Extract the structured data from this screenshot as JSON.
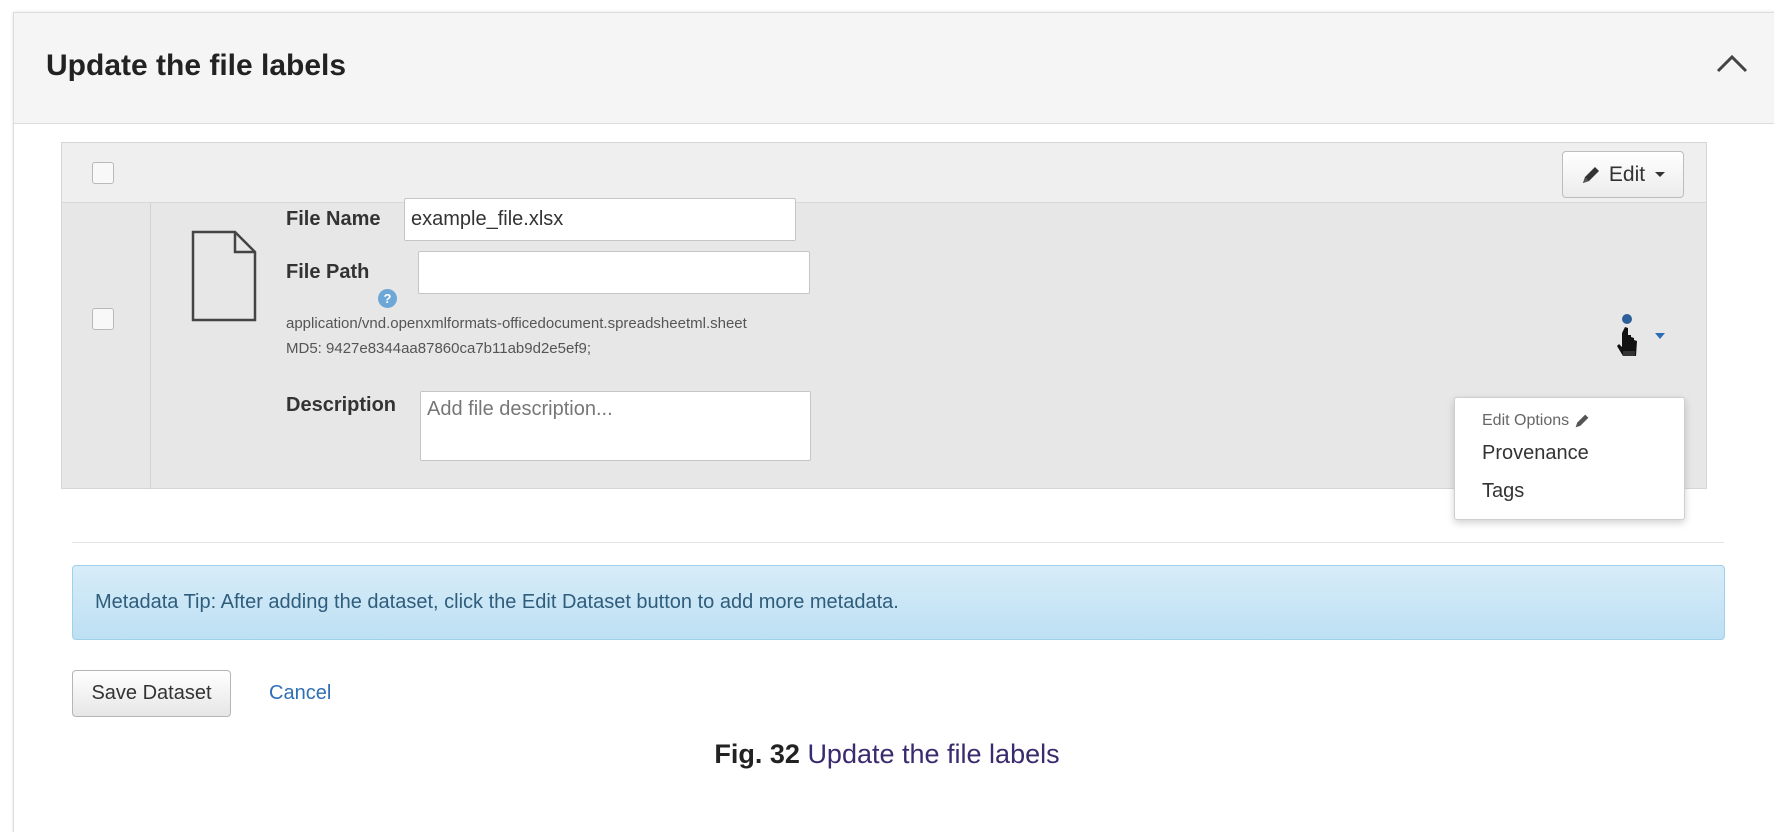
{
  "panel": {
    "title": "Update the file labels"
  },
  "table": {
    "edit_button": {
      "label": "Edit"
    },
    "file": {
      "name_label": "File Name",
      "name_value": "example_file.xlsx",
      "path_label": "File Path",
      "path_value": "",
      "mime_type": "application/vnd.openxmlformats-officedocument.spreadsheetml.sheet",
      "md5": "MD5: 9427e8344aa87860ca7b11ab9d2e5ef9;",
      "description_label": "Description",
      "description_placeholder": "Add file description..."
    },
    "options_menu": {
      "header": "Edit Options",
      "items": [
        "Provenance",
        "Tags"
      ]
    }
  },
  "tip": {
    "text": "Metadata Tip: After adding the dataset, click the Edit Dataset button to add more metadata."
  },
  "actions": {
    "save_label": "Save Dataset",
    "cancel_label": "Cancel"
  },
  "caption": {
    "number": "Fig. 32",
    "title": "Update the file labels"
  },
  "colors": {
    "header_bg": "#f5f5f5",
    "row_bg": "#e7e7e7",
    "tip_bg": "#c9e6f6",
    "tip_text": "#2f5d7c",
    "link": "#2f6fb5",
    "caption_link": "#3a2a6e"
  },
  "icons": {
    "collapse": "chevron-up-icon",
    "file": "file-icon",
    "help": "question-circle-icon",
    "edit": "pencil-icon",
    "options": "hand-pointer-icon"
  }
}
